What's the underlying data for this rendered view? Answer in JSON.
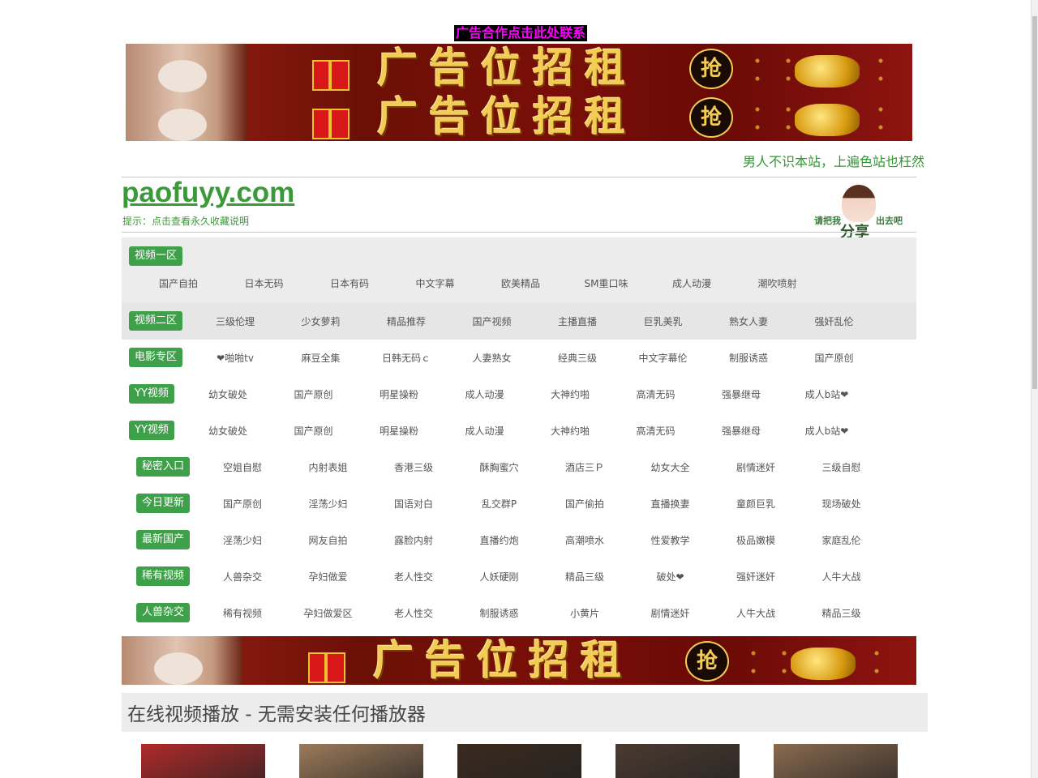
{
  "ad_contact": "广告合作点击此处联系",
  "banner": {
    "text": "广告位招租",
    "grab": "抢"
  },
  "tagline": "男人不识本站，上遍色站也枉然",
  "site": {
    "logo": "paofuyy.com",
    "tip": "提示：点击查看永久收藏说明"
  },
  "share": {
    "left": "请把我",
    "right": "出去吧",
    "big": "分享"
  },
  "nav": [
    {
      "badge": "视频一区",
      "links": [
        "国产自拍",
        "日本无码",
        "日本有码",
        "中文字幕",
        "欧美精品",
        "SM重口味",
        "成人动漫",
        "潮吹喷射"
      ]
    },
    {
      "badge": "视频二区",
      "links": [
        "三级伦理",
        "少女萝莉",
        "精品推荐",
        "国产视频",
        "主播直播",
        "巨乳美乳",
        "熟女人妻",
        "强奸乱伦"
      ]
    },
    {
      "badge": "电影专区",
      "links": [
        "❤啪啪tv",
        "麻豆全集",
        "日韩无码ｃ",
        "人妻熟女",
        "经典三级",
        "中文字幕伦",
        "制服诱惑",
        "国产原创"
      ]
    },
    {
      "badge": "YY视频",
      "links": [
        "幼女破处",
        "国产原创",
        "明星操粉",
        "成人动漫",
        "大神约啪",
        "高清无码",
        "强暴继母",
        "成人b站❤"
      ]
    },
    {
      "badge": "YY视频",
      "links": [
        "幼女破处",
        "国产原创",
        "明星操粉",
        "成人动漫",
        "大神约啪",
        "高清无码",
        "强暴继母",
        "成人b站❤"
      ]
    },
    {
      "badge": "秘密入口",
      "links": [
        "空姐自慰",
        "内射表姐",
        "香港三级",
        "酥胸蜜穴",
        "酒店三Ｐ",
        "幼女大全",
        "剧情迷奸",
        "三级自慰"
      ]
    },
    {
      "badge": "今日更新",
      "links": [
        "国产原创",
        "淫荡少妇",
        "国语对白",
        "乱交群P",
        "国产偷拍",
        "直播换妻",
        "童颜巨乳",
        "现场破处"
      ]
    },
    {
      "badge": "最新国产",
      "links": [
        "淫荡少妇",
        "网友自拍",
        "露脸内射",
        "直播约炮",
        "高潮喷水",
        "性爱教学",
        "极品嫩模",
        "家庭乱伦"
      ]
    },
    {
      "badge": "稀有视频",
      "links": [
        "人兽杂交",
        "孕妇做爱",
        "老人性交",
        "人妖硬刚",
        "精品三级",
        "破处❤",
        "强奸迷奸",
        "人牛大战"
      ]
    },
    {
      "badge": "人兽杂交",
      "links": [
        "稀有视频",
        "孕妇做爱区",
        "老人性交",
        "制服诱惑",
        "小黄片",
        "剧情迷奸",
        "人牛大战",
        "精品三级"
      ]
    }
  ],
  "video_section_title": "在线视频播放 - 无需安装任何播放器",
  "thumb_colors": [
    "#b02a2a",
    "#9c7a5a",
    "#3a2a1e",
    "#4a3a30",
    "#8a6a50"
  ]
}
